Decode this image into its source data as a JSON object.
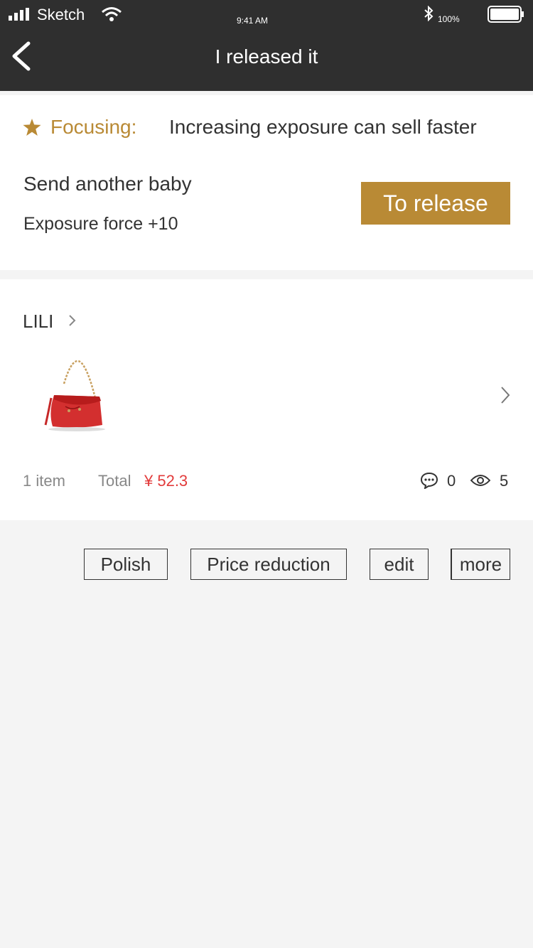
{
  "status_bar": {
    "carrier": "Sketch",
    "time": "9:41 AM",
    "battery_percent": "100%"
  },
  "navbar": {
    "title": "I released it",
    "back_icon": "chevron-left-icon"
  },
  "focus_card": {
    "label": "Focusing:",
    "text": "Increasing exposure can sell faster",
    "send_title": "Send another baby",
    "send_sub": "Exposure force +10",
    "release_button": "To release",
    "accent_color": "#b98a35"
  },
  "item_card": {
    "seller": "LILI",
    "product_image": "red-handbag",
    "item_count": "1 item",
    "total_label": "Total",
    "total_value": "¥ 52.3",
    "comments": "0",
    "views": "5",
    "price_color": "#e23b3b"
  },
  "actions": {
    "polish": "Polish",
    "price_reduction": "Price reduction",
    "edit": "edit",
    "more": "more"
  }
}
